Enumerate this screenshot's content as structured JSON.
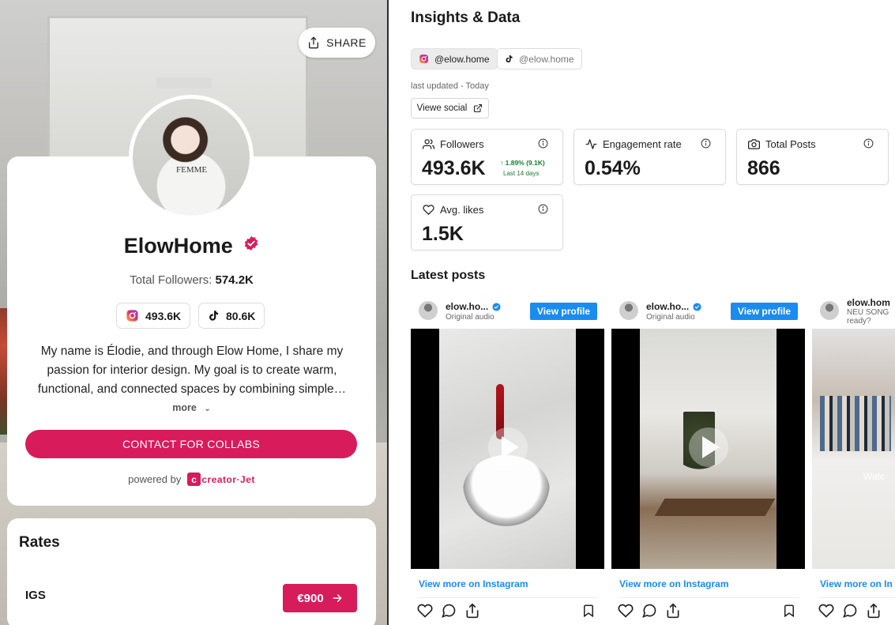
{
  "colors": {
    "brand": "#d81b5b",
    "link": "#1a8cf0",
    "positive": "#1a7d2f"
  },
  "profile": {
    "share_label": "SHARE",
    "name": "ElowHome",
    "total_followers_label": "Total Followers:",
    "total_followers_value": "574.2K",
    "instagram_followers": "493.6K",
    "tiktok_followers": "80.6K",
    "bio": "My name is Élodie, and through Elow Home, I share my passion for interior design. My goal is to create warm, functional, and connected spaces by combining simple…",
    "more_label": "more",
    "contact_button": "CONTACT FOR COLLABS",
    "powered_by": "powered by",
    "brand_logo": "creator·Jet",
    "tee_print": "FEMME"
  },
  "rates": {
    "title": "Rates",
    "items": [
      {
        "label": "IGS",
        "price": "€900"
      }
    ]
  },
  "insights": {
    "title": "Insights & Data",
    "handles": [
      {
        "platform": "instagram",
        "label": "@elow.home",
        "active": true
      },
      {
        "platform": "tiktok",
        "label": "@elow.home",
        "active": false
      }
    ],
    "last_updated": "last updated - Today",
    "view_social": "Viewe social",
    "stats": [
      {
        "label": "Followers",
        "value": "493.6K",
        "delta": "1.89% (9.1K)",
        "delta_period": "Last 14 days",
        "icon": "users-icon"
      },
      {
        "label": "Engagement rate",
        "value": "0.54%",
        "icon": "activity-icon"
      },
      {
        "label": "Total Posts",
        "value": "866",
        "icon": "camera-icon"
      },
      {
        "label": "Avg. likes",
        "value": "1.5K",
        "icon": "heart-icon"
      }
    ]
  },
  "latest_posts": {
    "title": "Latest posts",
    "posts": [
      {
        "account": "elow.ho...",
        "subtitle": "Original audio",
        "view_profile": "View profile",
        "view_more": "View more on Instagram"
      },
      {
        "account": "elow.ho...",
        "subtitle": "Original audio",
        "view_profile": "View profile",
        "view_more": "View more on Instagram"
      },
      {
        "account": "elow.hom",
        "subtitle": "NEU SONG",
        "subtitle2": "ready?",
        "overlay": "Watc",
        "view_more": "View more on In"
      }
    ]
  }
}
